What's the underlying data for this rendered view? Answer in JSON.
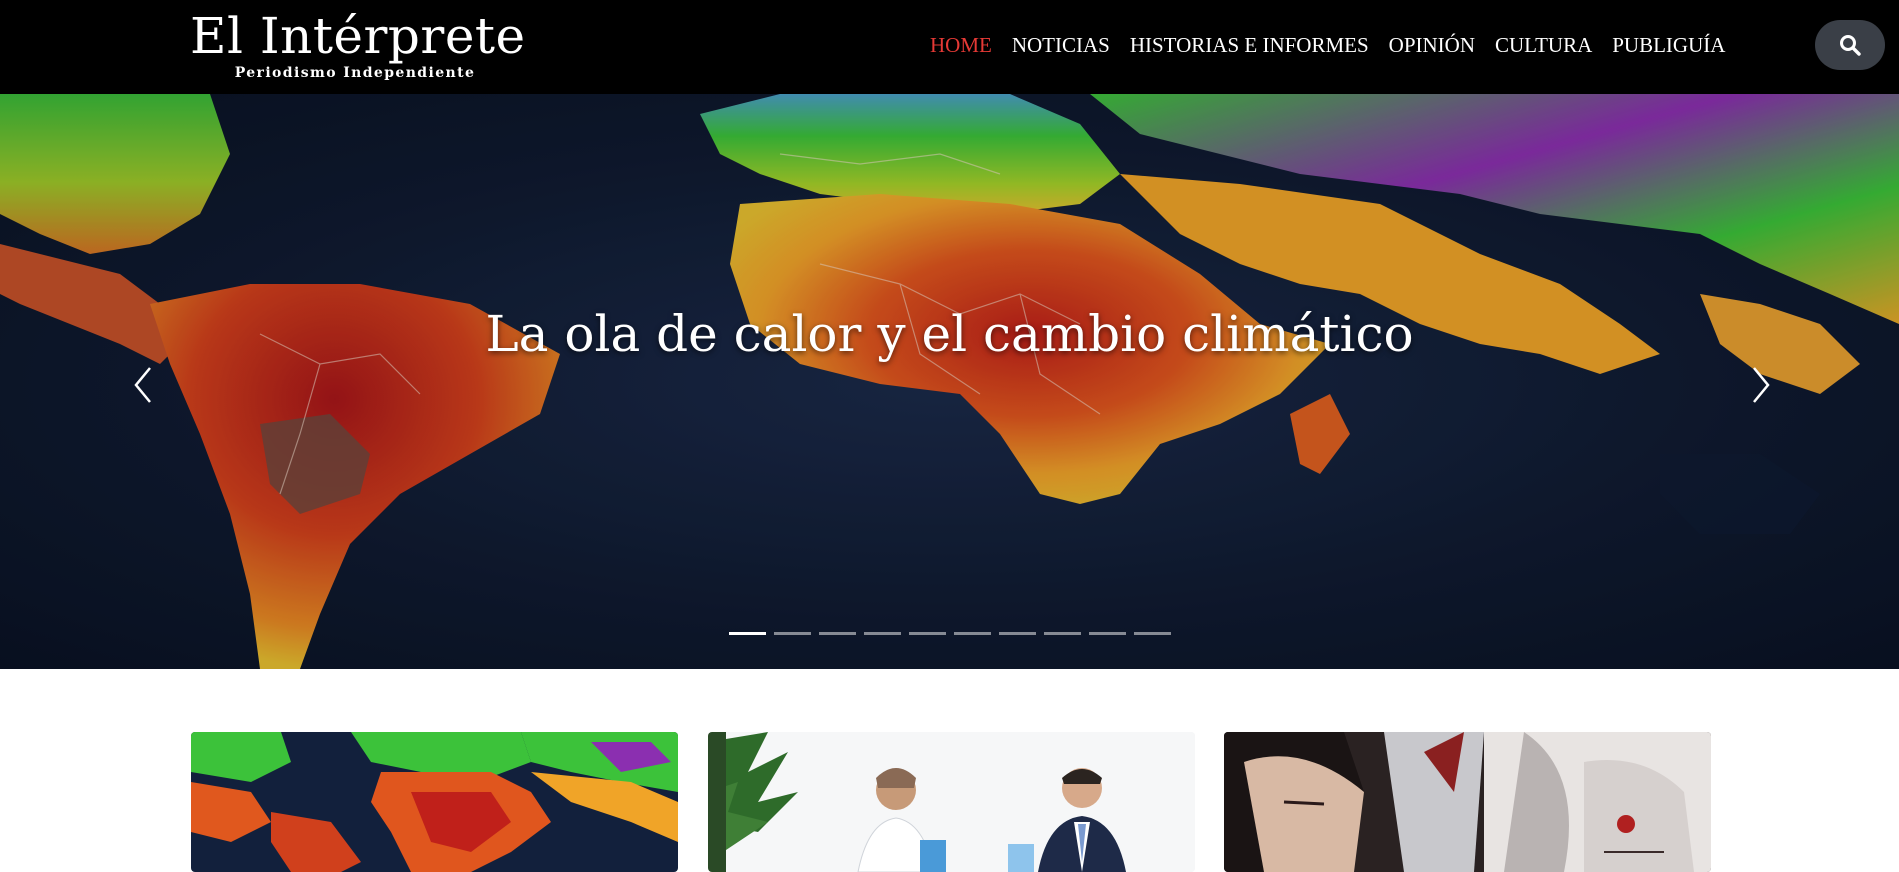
{
  "header": {
    "logo_title": "El Intérprete",
    "logo_subtitle": "Periodismo Independiente",
    "nav": [
      {
        "label": "HOME",
        "active": true
      },
      {
        "label": "NOTICIAS",
        "active": false
      },
      {
        "label": "HISTORIAS E INFORMES",
        "active": false
      },
      {
        "label": "OPINIÓN",
        "active": false
      },
      {
        "label": "CULTURA",
        "active": false
      },
      {
        "label": "PUBLIGUÍA",
        "active": false
      }
    ],
    "search_icon": "search-icon"
  },
  "hero": {
    "title": "La ola de calor y el cambio climático",
    "prev_icon": "chevron-left-icon",
    "next_icon": "chevron-right-icon",
    "slide_count": 10,
    "active_slide": 1
  },
  "colors": {
    "header_bg": "#000000",
    "nav_active": "#e53935",
    "nav_text": "#ffffff",
    "search_bg": "#3a3f47"
  }
}
